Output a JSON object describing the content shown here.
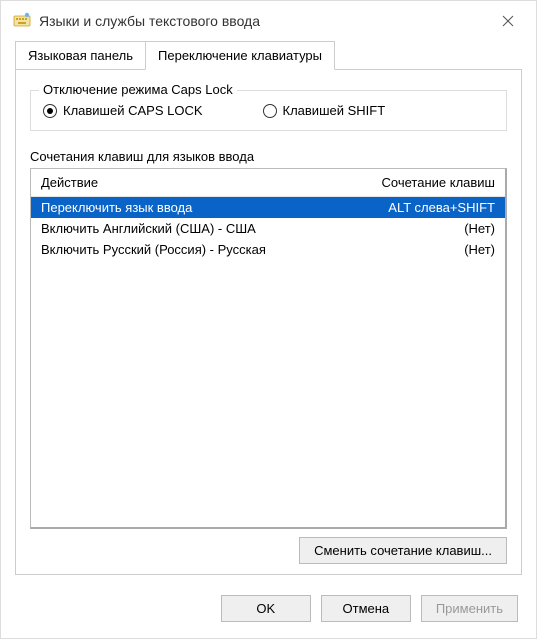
{
  "window": {
    "title": "Языки и службы текстового ввода"
  },
  "tabs": {
    "tab1": "Языковая панель",
    "tab2": "Переключение клавиатуры"
  },
  "capslock_group": {
    "legend": "Отключение режима Caps Lock",
    "radio_caps": "Клавишей CAPS LOCK",
    "radio_shift": "Клавишей SHIFT"
  },
  "hotkeys": {
    "section_label": "Сочетания клавиш для языков ввода",
    "col_action": "Действие",
    "col_shortcut": "Сочетание клавиш",
    "rows": [
      {
        "action": "Переключить язык ввода",
        "shortcut": "ALT слева+SHIFT"
      },
      {
        "action": "Включить Английский (США) - США",
        "shortcut": "(Нет)"
      },
      {
        "action": "Включить Русский (Россия) - Русская",
        "shortcut": "(Нет)"
      }
    ],
    "change_button": "Сменить сочетание клавиш..."
  },
  "dialog_buttons": {
    "ok": "OK",
    "cancel": "Отмена",
    "apply": "Применить"
  }
}
